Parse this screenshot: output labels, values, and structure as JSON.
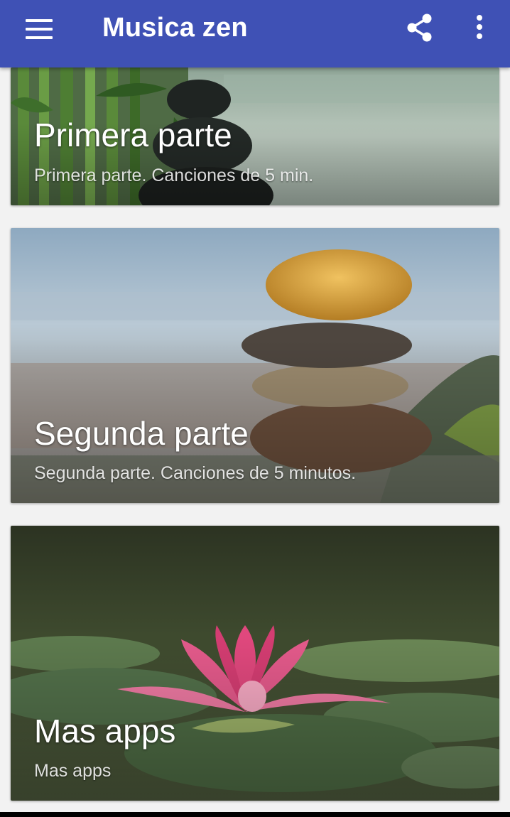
{
  "appbar": {
    "title": "Musica zen",
    "menu_icon": "hamburger-menu-icon",
    "share_icon": "share-icon",
    "more_icon": "more-vert-icon",
    "color": "#3f51b5"
  },
  "cards": [
    {
      "title": "Primera parte",
      "subtitle": "Primera parte. Canciones de 5 min.",
      "image": "bamboo-zen-stones-photo"
    },
    {
      "title": "Segunda parte",
      "subtitle": "Segunda parte. Canciones de 5 minutos.",
      "image": "stacked-stones-photo"
    },
    {
      "title": "Mas apps",
      "subtitle": "Mas apps",
      "image": "pink-lotus-photo"
    }
  ]
}
